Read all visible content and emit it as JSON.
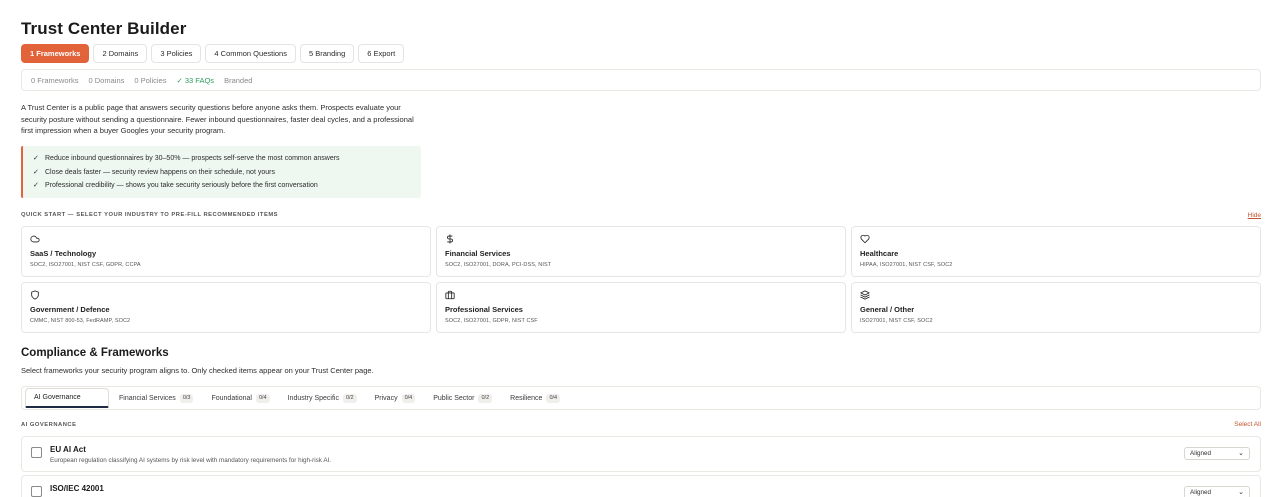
{
  "page": {
    "title": "Trust Center Builder"
  },
  "steps": [
    {
      "label": "1 Frameworks",
      "active": true
    },
    {
      "label": "2 Domains"
    },
    {
      "label": "3 Policies"
    },
    {
      "label": "4 Common Questions"
    },
    {
      "label": "5 Branding"
    },
    {
      "label": "6 Export"
    }
  ],
  "status": {
    "frameworks": "0 Frameworks",
    "domains": "0 Domains",
    "policies": "0 Policies",
    "faqs_check": "✓",
    "faqs": "33 FAQs",
    "branded": "Branded"
  },
  "intro": {
    "text": "A Trust Center is a public page that answers security questions before anyone asks them. Prospects evaluate your security posture without sending a questionnaire. Fewer inbound questionnaires, faster deal cycles, and a professional first impression when a buyer Googles your security program."
  },
  "benefits": [
    "Reduce inbound questionnaires by 30–50% — prospects self-serve the most common answers",
    "Close deals faster — security review happens on their schedule, not yours",
    "Professional credibility — shows you take security seriously before the first conversation"
  ],
  "quick_start": {
    "label": "QUICK START — SELECT YOUR INDUSTRY TO PRE-FILL RECOMMENDED ITEMS",
    "hide_label": "Hide",
    "cards": [
      {
        "icon": "cloud-icon",
        "title": "SaaS / Technology",
        "sub": "SOC2, ISO27001, NIST CSF, GDPR, CCPA"
      },
      {
        "icon": "dollar-icon",
        "title": "Financial Services",
        "sub": "SOC2, ISO27001, DORA, PCI-DSS, NIST"
      },
      {
        "icon": "heart-icon",
        "title": "Healthcare",
        "sub": "HIPAA, ISO27001, NIST CSF, SOC2"
      },
      {
        "icon": "shield-icon",
        "title": "Government / Defence",
        "sub": "CMMC, NIST 800-53, FedRAMP, SOC2"
      },
      {
        "icon": "briefcase-icon",
        "title": "Professional Services",
        "sub": "SOC2, ISO27001, GDPR, NIST CSF"
      },
      {
        "icon": "layers-icon",
        "title": "General / Other",
        "sub": "ISO27001, NIST CSF, SOC2"
      }
    ]
  },
  "compliance": {
    "title": "Compliance & Frameworks",
    "description": "Select frameworks your security program aligns to. Only checked items appear on your Trust Center page.",
    "tabs": [
      {
        "label": "AI Governance",
        "count": "",
        "active": true
      },
      {
        "label": "Financial Services",
        "count": "0/3"
      },
      {
        "label": "Foundational",
        "count": "0/4"
      },
      {
        "label": "Industry Specific",
        "count": "0/2"
      },
      {
        "label": "Privacy",
        "count": "0/4"
      },
      {
        "label": "Public Sector",
        "count": "0/2"
      },
      {
        "label": "Resilience",
        "count": "0/4"
      }
    ],
    "group_label": "AI GOVERNANCE",
    "select_all": "Select All",
    "frameworks": [
      {
        "name": "EU AI Act",
        "desc": "European regulation classifying AI systems by risk level with mandatory requirements for high-risk AI.",
        "status": "Aligned",
        "checked": false
      },
      {
        "name": "ISO/IEC 42001",
        "desc": "",
        "status": "Aligned",
        "checked": false
      }
    ]
  },
  "colors": {
    "accent": "#e2623a",
    "success": "#2f9a5b",
    "benefit_bg": "#eef7f0"
  }
}
